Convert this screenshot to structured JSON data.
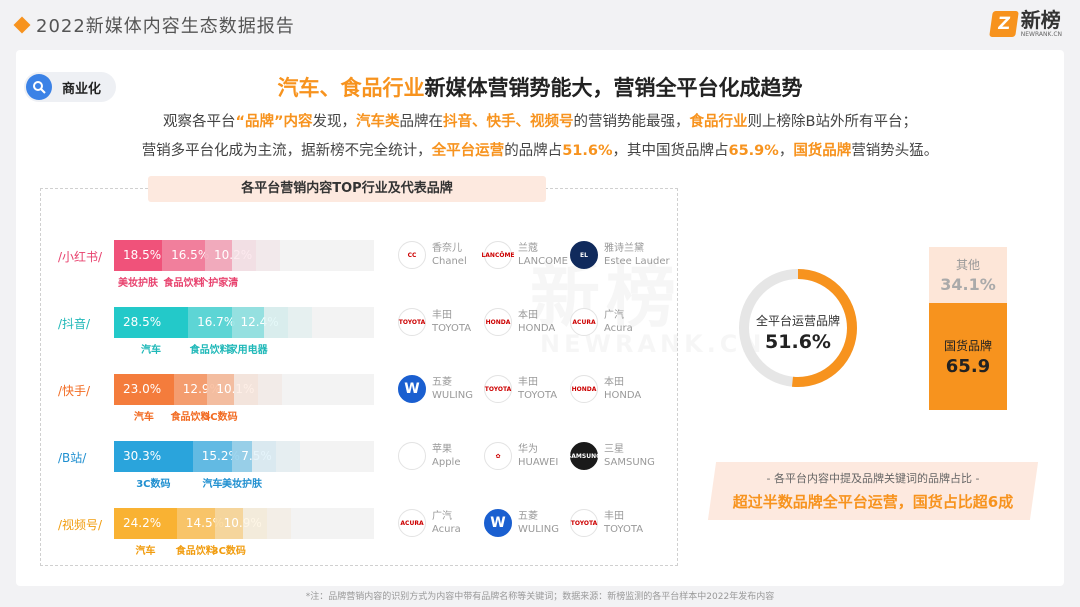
{
  "report_title": "2022新媒体内容生态数据报告",
  "logo": {
    "mark": "Z",
    "cn": "新榜",
    "en": "NEWRANK.CN"
  },
  "section_tag": "商业化",
  "headline": {
    "hl": "汽车、食品行业",
    "rest": "新媒体营销势能大，营销全平台化成趋势"
  },
  "sub1": [
    {
      "t": "观察各平台",
      "h": false
    },
    {
      "t": "“品牌”内容",
      "h": true
    },
    {
      "t": "发现，",
      "h": false
    },
    {
      "t": "汽车类",
      "h": true
    },
    {
      "t": "品牌在",
      "h": false
    },
    {
      "t": "抖音、快手、视频号",
      "h": true
    },
    {
      "t": "的营销势能最强，",
      "h": false
    },
    {
      "t": "食品行业",
      "h": true
    },
    {
      "t": "则上榜除B站外所有平台；",
      "h": false
    }
  ],
  "sub2": [
    {
      "t": "营销多平台化成为主流，据新榜不完全统计，",
      "h": false
    },
    {
      "t": "全平台运营",
      "h": true
    },
    {
      "t": "的品牌占",
      "h": false
    },
    {
      "t": "51.6%",
      "h": true
    },
    {
      "t": "，其中国货品牌占",
      "h": false
    },
    {
      "t": "65.9%",
      "h": true
    },
    {
      "t": "，",
      "h": false
    },
    {
      "t": "国货品牌",
      "h": true
    },
    {
      "t": "营销势头猛。",
      "h": false
    }
  ],
  "chart_data": {
    "type": "bar",
    "title": "各平台营销内容TOP行业及代表品牌",
    "rows": [
      {
        "platform": "/小红书/",
        "color": "#f0527a",
        "label_color": "#e8426e",
        "segments": [
          {
            "name": "美妆护肤",
            "value": 18.5,
            "label": "18.5%"
          },
          {
            "name": "食品饮料",
            "value": 16.5,
            "label": "16.5%"
          },
          {
            "name": "个护家清",
            "value": 10.2,
            "label": "10.2%"
          }
        ],
        "brands": [
          {
            "cn": "香奈儿",
            "en": "Chanel",
            "logo": "chanel-logo",
            "mark": "CC",
            "style": ""
          },
          {
            "cn": "兰蔻",
            "en": "LANCOME",
            "logo": "lancome-logo",
            "mark": "LANCÔME",
            "style": ""
          },
          {
            "cn": "雅诗兰黛",
            "en": "Estee Lauder",
            "logo": "estee-lauder-logo",
            "mark": "EL",
            "style": "navy"
          }
        ]
      },
      {
        "platform": "/抖音/",
        "color": "#23c9c9",
        "label_color": "#1fb8b8",
        "segments": [
          {
            "name": "汽车",
            "value": 28.5,
            "label": "28.5%"
          },
          {
            "name": "食品饮料",
            "value": 16.7,
            "label": "16.7%"
          },
          {
            "name": "家用电器",
            "value": 12.4,
            "label": "12.4%"
          }
        ],
        "brands": [
          {
            "cn": "丰田",
            "en": "TOYOTA",
            "logo": "toyota-logo",
            "mark": "TOYOTA",
            "style": ""
          },
          {
            "cn": "本田",
            "en": "HONDA",
            "logo": "honda-logo",
            "mark": "HONDA",
            "style": ""
          },
          {
            "cn": "广汽",
            "en": "Acura",
            "logo": "acura-logo",
            "mark": "ACURA",
            "style": ""
          }
        ]
      },
      {
        "platform": "/快手/",
        "color": "#f47c3c",
        "label_color": "#f26b22",
        "segments": [
          {
            "name": "汽车",
            "value": 23.0,
            "label": "23.0%"
          },
          {
            "name": "食品饮料",
            "value": 12.9,
            "label": "12.9%"
          },
          {
            "name": "3C数码",
            "value": 10.1,
            "label": "10.1%"
          }
        ],
        "brands": [
          {
            "cn": "五菱",
            "en": "WULING",
            "logo": "wuling-logo",
            "mark": "W",
            "style": "blue"
          },
          {
            "cn": "丰田",
            "en": "TOYOTA",
            "logo": "toyota-logo",
            "mark": "TOYOTA",
            "style": ""
          },
          {
            "cn": "本田",
            "en": "HONDA",
            "logo": "honda-logo",
            "mark": "HONDA",
            "style": ""
          }
        ]
      },
      {
        "platform": "/B站/",
        "color": "#2aa4dc",
        "label_color": "#1f8fd0",
        "segments": [
          {
            "name": "3C数码",
            "value": 30.3,
            "label": "30.3%"
          },
          {
            "name": "汽车",
            "value": 15.2,
            "label": "15.2%"
          },
          {
            "name": "美妆护肤",
            "value": 7.5,
            "label": "7.5%"
          }
        ],
        "brands": [
          {
            "cn": "苹果",
            "en": "Apple",
            "logo": "apple-logo",
            "mark": "",
            "style": ""
          },
          {
            "cn": "华为",
            "en": "HUAWEI",
            "logo": "huawei-logo",
            "mark": "✿",
            "style": ""
          },
          {
            "cn": "三星",
            "en": "SAMSUNG",
            "logo": "samsung-logo",
            "mark": "SAMSUNG",
            "style": "dark"
          }
        ]
      },
      {
        "platform": "/视频号/",
        "color": "#f9b233",
        "label_color": "#f19c0e",
        "segments": [
          {
            "name": "汽车",
            "value": 24.2,
            "label": "24.2%"
          },
          {
            "name": "食品饮料",
            "value": 14.5,
            "label": "14.5%"
          },
          {
            "name": "3C数码",
            "value": 10.9,
            "label": "10.9%"
          }
        ],
        "brands": [
          {
            "cn": "广汽",
            "en": "Acura",
            "logo": "acura-logo",
            "mark": "ACURA",
            "style": ""
          },
          {
            "cn": "五菱",
            "en": "WULING",
            "logo": "wuling-logo",
            "mark": "W",
            "style": "blue"
          },
          {
            "cn": "丰田",
            "en": "TOYOTA",
            "logo": "toyota-logo",
            "mark": "TOYOTA",
            "style": ""
          }
        ]
      }
    ],
    "donut": {
      "label": "全平台运营品牌",
      "value": 51.6,
      "display": "51.6%",
      "color": "#f7931e",
      "rest_color": "#e6e6e6"
    },
    "stack": [
      {
        "name": "其他",
        "value": 34.1,
        "display": "34.1%"
      },
      {
        "name": "国货品牌",
        "value": 65.9,
        "display": "65.9"
      }
    ]
  },
  "conclusion": {
    "sub": "- 各平台内容中提及品牌关键词的品牌占比 -",
    "main": "超过半数品牌全平台运营，国货占比超6成"
  },
  "footnote": "*注：品牌营销内容的识别方式为内容中带有品牌名称等关键词；数据来源：新榜监测的各平台样本中2022年发布内容",
  "watermark": {
    "cn": "新榜",
    "en": "NEWRANK.CN"
  }
}
